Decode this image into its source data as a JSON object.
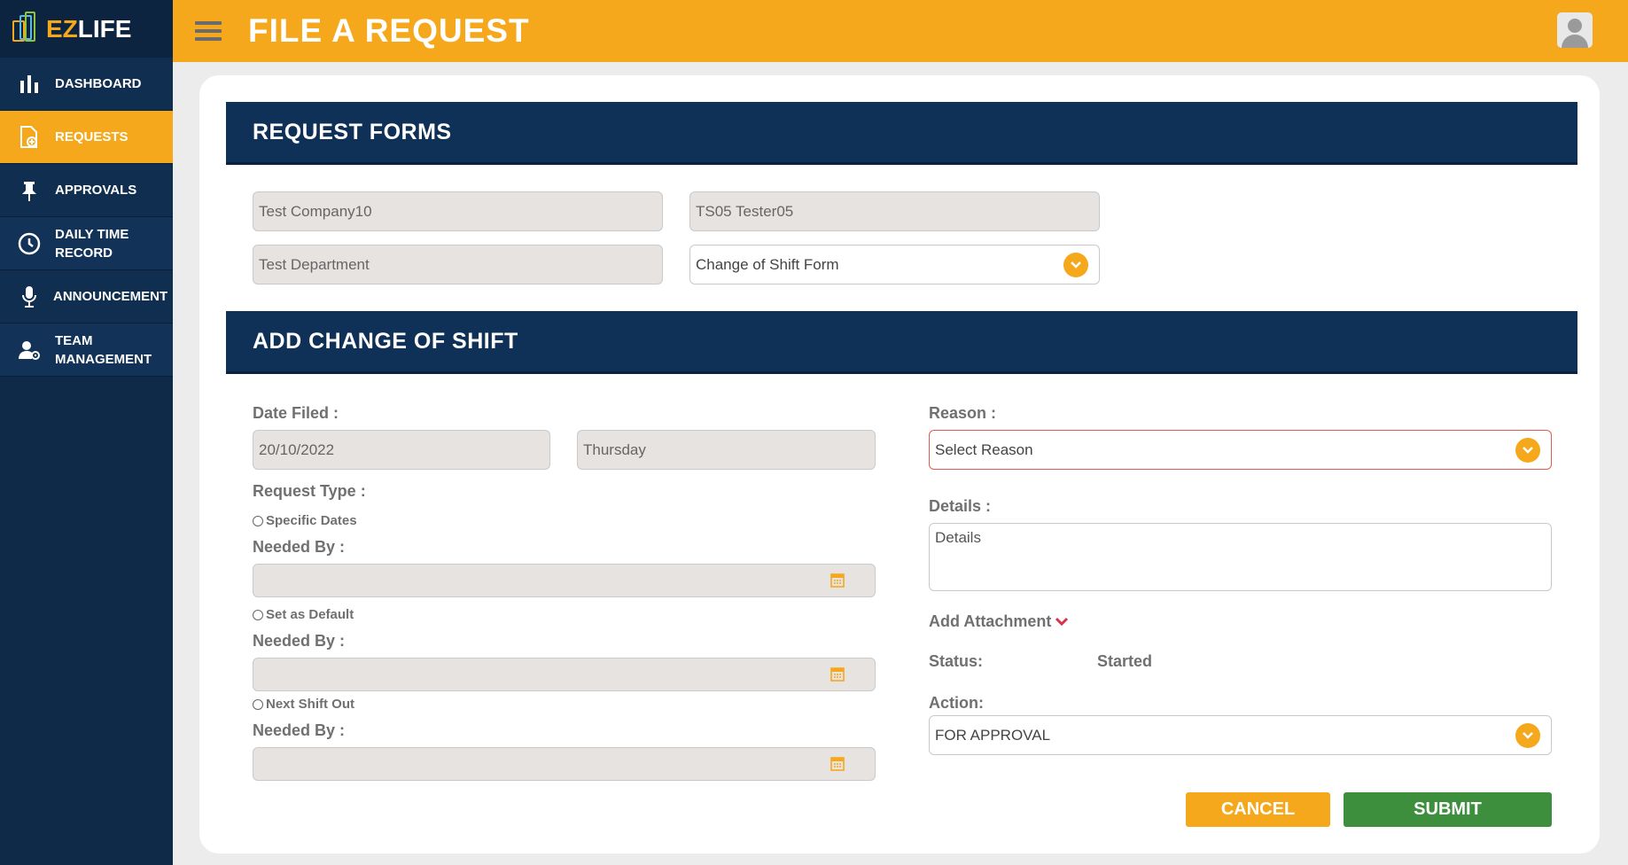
{
  "app": {
    "logo_text_ez": "EZ",
    "logo_text_life": "LIFE"
  },
  "sidebar": {
    "items": [
      {
        "label": "DASHBOARD",
        "icon": "bar-chart-icon"
      },
      {
        "label": "REQUESTS",
        "icon": "document-add-icon",
        "active": true
      },
      {
        "label": "APPROVALS",
        "icon": "pin-icon"
      },
      {
        "label": "DAILY TIME RECORD",
        "icon": "clock-icon"
      },
      {
        "label": "ANNOUNCEMENT",
        "icon": "microphone-icon"
      },
      {
        "label": "TEAM MANAGEMENT",
        "icon": "user-gear-icon"
      }
    ]
  },
  "header": {
    "title": "FILE A REQUEST"
  },
  "request_forms": {
    "title": "REQUEST FORMS",
    "company": "Test Company10",
    "employee": "TS05 Tester05",
    "department": "Test Department",
    "form_type": "Change of Shift Form"
  },
  "change_of_shift": {
    "title": "ADD CHANGE OF SHIFT",
    "date_filed_label": "Date Filed :",
    "date_filed": "20/10/2022",
    "day": "Thursday",
    "request_type_label": "Request Type :",
    "options": [
      {
        "label": "Specific Dates",
        "needed_by_label": "Needed By :"
      },
      {
        "label": "Set as Default",
        "needed_by_label": "Needed By :"
      },
      {
        "label": "Next Shift Out",
        "needed_by_label": "Needed By :"
      }
    ],
    "reason_label": "Reason :",
    "reason_value": "Select Reason",
    "details_label": "Details :",
    "details_placeholder": "Details",
    "attachment_label": "Add Attachment",
    "status_label": "Status:",
    "status_value": "Started",
    "action_label": "Action:",
    "action_value": "FOR APPROVAL",
    "cancel_label": "CANCEL",
    "submit_label": "SUBMIT"
  },
  "colors": {
    "accent": "#f5a81c",
    "navy": "#0f3157",
    "sidebar": "#0f2a48",
    "submit": "#3d8f3d",
    "error_border": "#e05a55"
  }
}
